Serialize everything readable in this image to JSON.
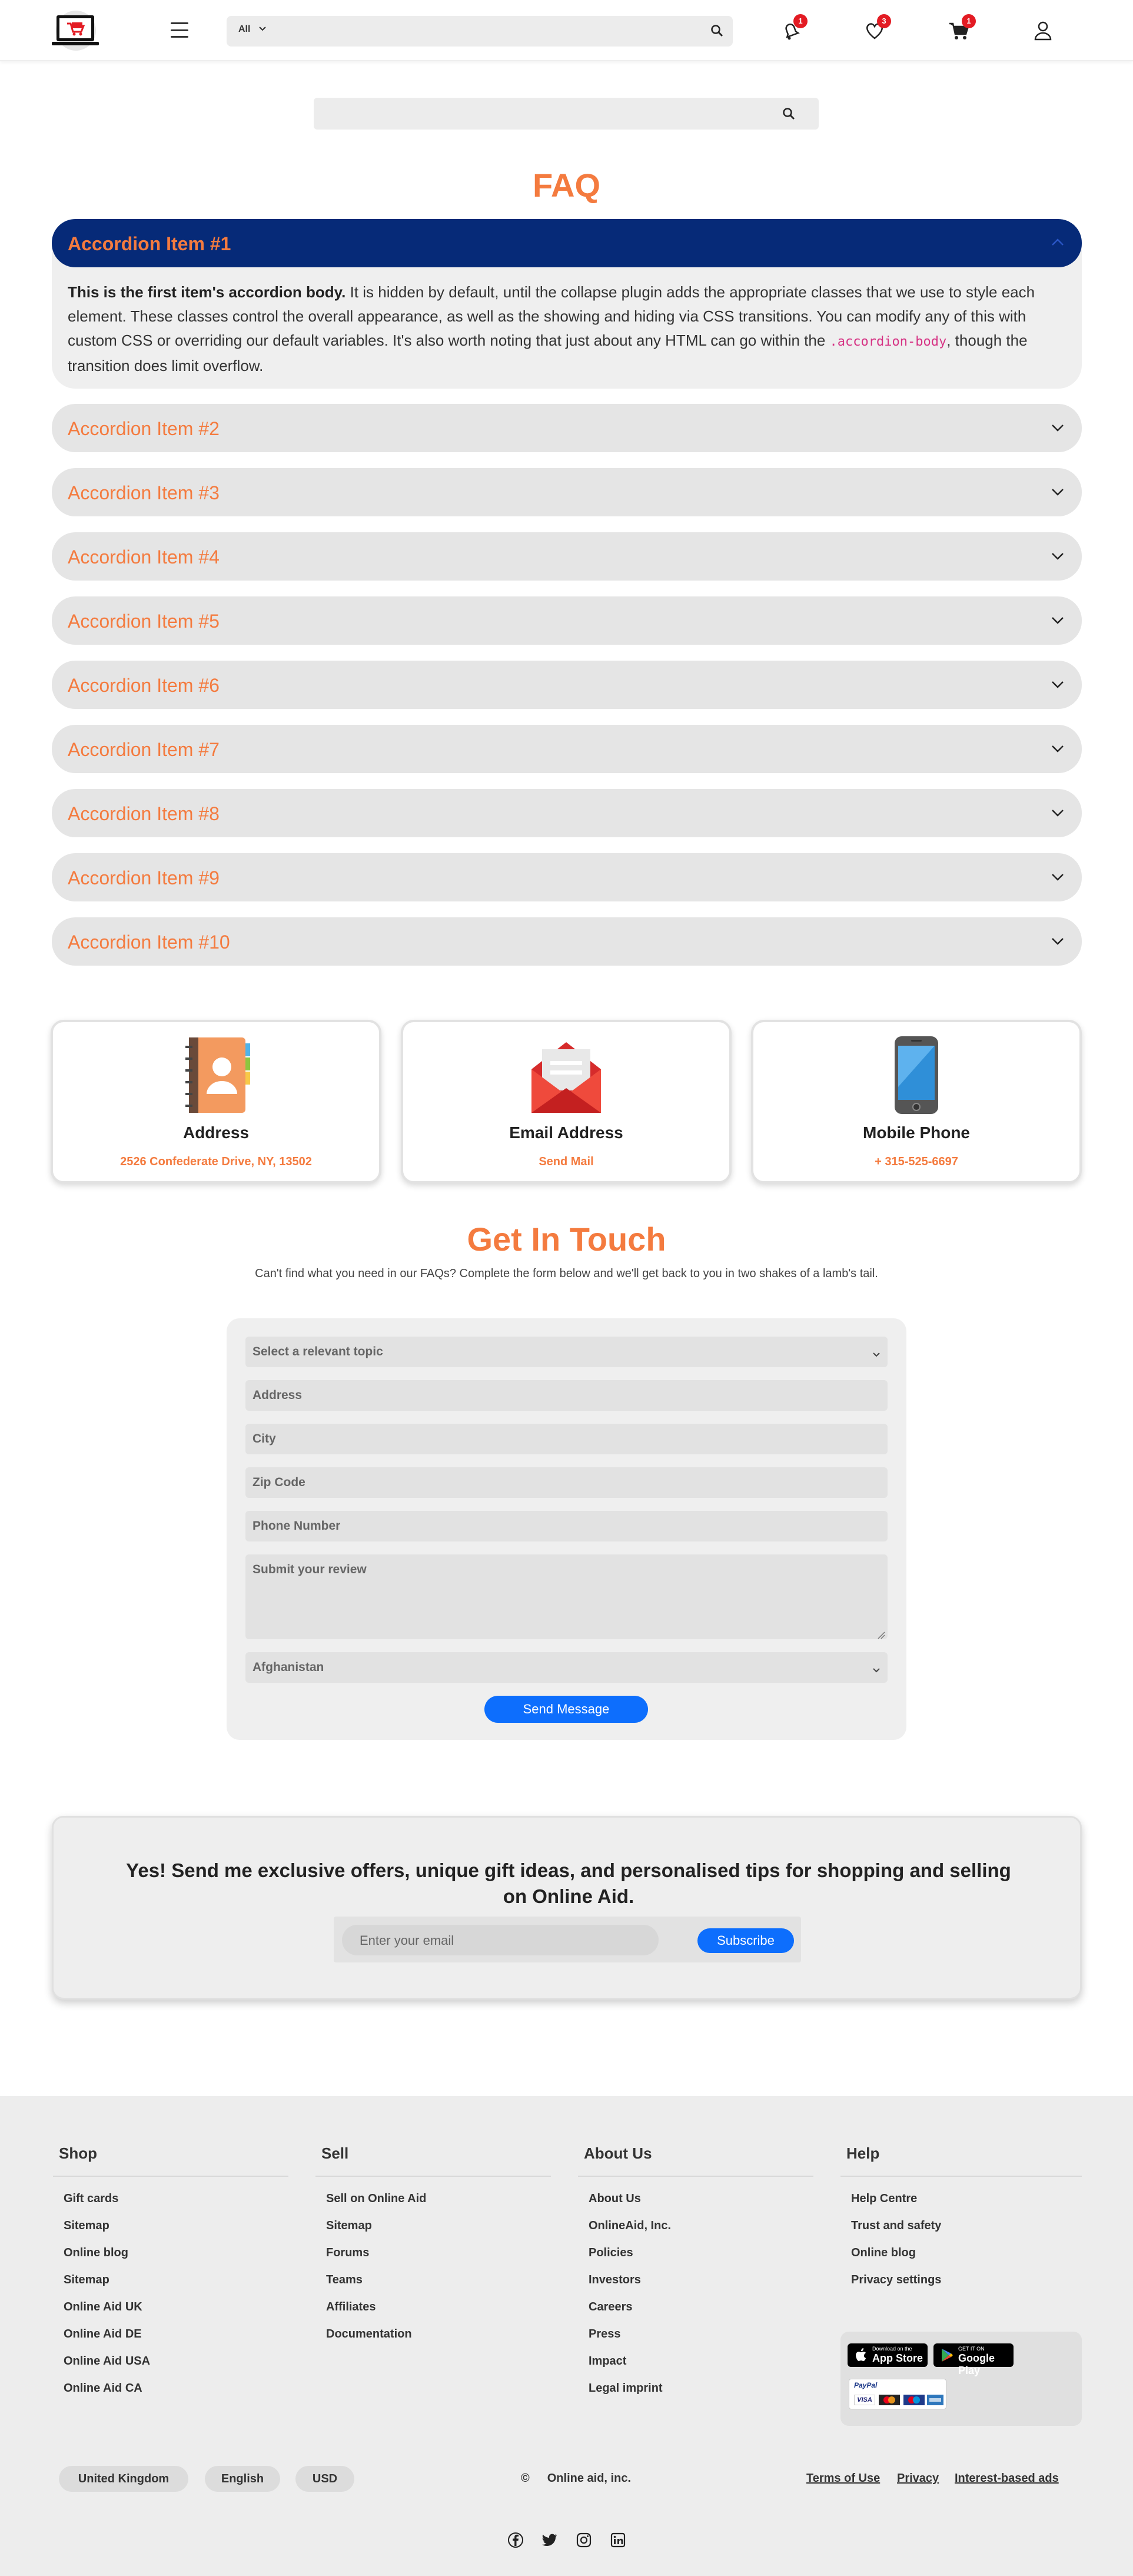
{
  "header": {
    "search": {
      "category": "All"
    },
    "badges": {
      "notifications": "1",
      "wishlist": "3",
      "cart": "1"
    }
  },
  "faq": {
    "title": "FAQ",
    "open_item": {
      "label": "Accordion Item #1",
      "body_bold": "This is the first item's accordion body.",
      "body_text": " It is hidden by default, until the collapse plugin adds the appropriate classes that we use to style each element. These classes control the overall appearance, as well as the showing and hiding via CSS transitions. You can modify any of this with custom CSS or overriding our default variables. It's also worth noting that just about any HTML can go within the ",
      "body_code": ".accordion-body",
      "body_end": ", though the transition does limit overflow."
    },
    "items": [
      "Accordion Item #2",
      "Accordion Item #3",
      "Accordion Item #4",
      "Accordion Item #5",
      "Accordion Item #6",
      "Accordion Item #7",
      "Accordion Item #8",
      "Accordion Item #9",
      "Accordion Item #10"
    ]
  },
  "contact_cards": [
    {
      "title": "Address",
      "value": "2526 Confederate Drive, NY, 13502",
      "icon": "address-book-icon"
    },
    {
      "title": "Email Address",
      "value": "Send Mail",
      "icon": "envelope-icon"
    },
    {
      "title": "Mobile Phone",
      "value": "+ 315-525-6697",
      "icon": "phone-icon"
    }
  ],
  "get_in_touch": {
    "title": "Get In Touch",
    "subtitle": "Can't find what you need in our FAQs? Complete the form below and we'll get back to you in two shakes of a lamb's tail."
  },
  "form": {
    "topic": "Select a relevant topic",
    "address": "Address",
    "city": "City",
    "zip": "Zip Code",
    "phone": "Phone Number",
    "review": "Submit your review",
    "country": "Afghanistan",
    "submit": "Send Message"
  },
  "newsletter": {
    "title": "Yes! Send me exclusive offers, unique gift ideas, and personalised tips for shopping and selling on Online Aid.",
    "placeholder": "Enter your email",
    "button": "Subscribe"
  },
  "footer": {
    "columns": [
      {
        "title": "Shop",
        "links": [
          "Gift cards",
          "Sitemap",
          "Online blog",
          "Sitemap",
          "Online Aid UK",
          "Online Aid DE",
          "Online Aid USA",
          "Online Aid CA"
        ]
      },
      {
        "title": "Sell",
        "links": [
          "Sell on Online Aid",
          "Sitemap",
          "Forums",
          "Teams",
          "Affiliates",
          "Documentation"
        ]
      },
      {
        "title": "About Us",
        "links": [
          "About Us",
          "OnlineAid, Inc.",
          "Policies",
          "Investors",
          "Careers",
          "Press",
          "Impact",
          "Legal imprint"
        ]
      },
      {
        "title": "Help",
        "links": [
          "Help Centre",
          "Trust and safety",
          "Online blog",
          "Privacy settings"
        ]
      }
    ],
    "apps": {
      "app_store_small": "Download on the",
      "app_store": "App Store",
      "google_play_small": "GET IT ON",
      "google_play": "Google Play",
      "paypal": "PayPal",
      "cards": [
        "VISA"
      ]
    },
    "region": "United Kingdom",
    "language": "English",
    "currency": "USD",
    "copyright_symbol": "©",
    "copyright": "Online aid, inc.",
    "legal": [
      "Terms of Use",
      "Privacy",
      "Interest-based ads"
    ],
    "social": [
      "facebook-icon",
      "twitter-icon",
      "instagram-icon",
      "linkedin-icon"
    ]
  }
}
